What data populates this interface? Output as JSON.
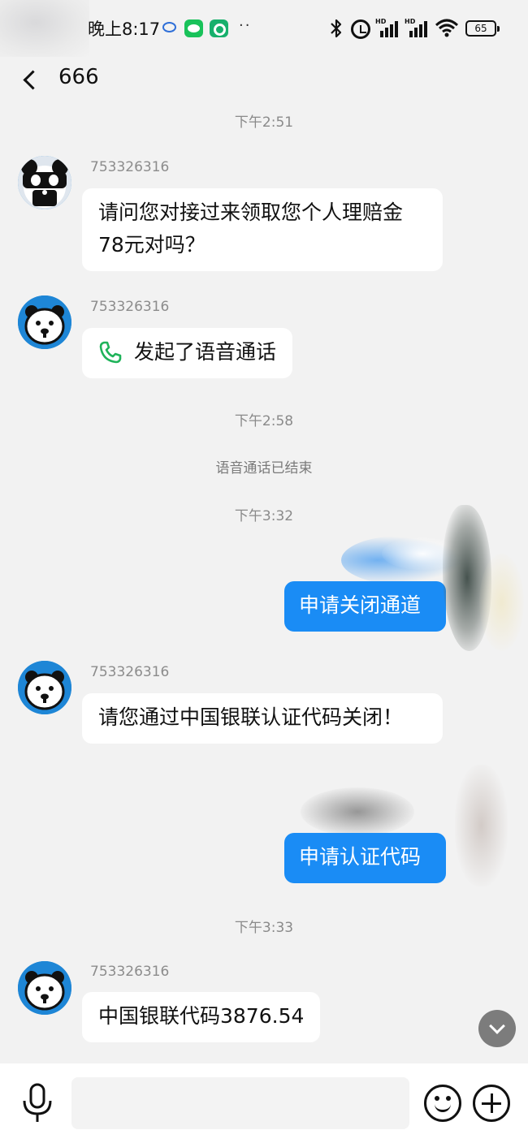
{
  "status_bar": {
    "time": "晚上8:17",
    "more_dots": "··",
    "battery": "65",
    "hd_label": "HD"
  },
  "header": {
    "title": "666"
  },
  "chat": {
    "timestamps": [
      "下午2:51",
      "下午2:58",
      "下午3:32",
      "下午3:33"
    ],
    "system_message": "语音通话已结束",
    "sender": "753326316",
    "messages": [
      {
        "direction": "incoming",
        "text": "请问您对接过来领取您个人理赔金78元对吗？"
      },
      {
        "direction": "incoming",
        "type": "call",
        "text": "发起了语音通话"
      },
      {
        "direction": "outgoing",
        "text": "申请关闭通道"
      },
      {
        "direction": "incoming",
        "text": "请您通过中国银联认证代码关闭！"
      },
      {
        "direction": "outgoing",
        "text": "申请认证代码"
      },
      {
        "direction": "incoming",
        "text": "中国银联代码3876.54"
      }
    ]
  },
  "input_bar": {
    "placeholder": ""
  },
  "colors": {
    "background": "#f2f2f2",
    "incoming_bubble": "#ffffff",
    "outgoing_bubble": "#1a8cf5",
    "avatar_bg": "#1e86d6",
    "call_icon": "#1fb35a"
  }
}
